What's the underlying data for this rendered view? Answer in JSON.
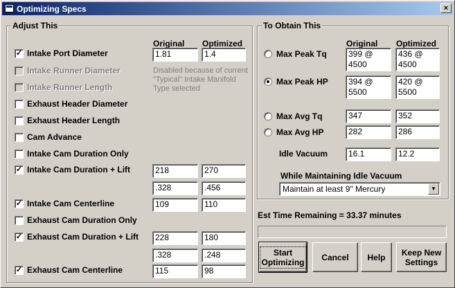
{
  "window": {
    "title": "Optimizing Specs",
    "close_glyph": "×"
  },
  "adjust": {
    "title": "Adjust This",
    "col_original": "Original",
    "col_optimized": "Optimized",
    "disabled_note": "Disabled because of current \"Typical\" Intake Manifold Type selected",
    "items": [
      {
        "label": "Intake Port Diameter",
        "checked": true,
        "enabled": true,
        "original": "1.81",
        "optimized": "1.4"
      },
      {
        "label": "Intake Runner Diameter",
        "checked": false,
        "enabled": false
      },
      {
        "label": "Intake Runner Length",
        "checked": false,
        "enabled": false
      },
      {
        "label": "Exhaust Header Diameter",
        "checked": false,
        "enabled": true
      },
      {
        "label": "Exhaust Header Length",
        "checked": false,
        "enabled": true
      },
      {
        "label": "Cam Advance",
        "checked": false,
        "enabled": true
      },
      {
        "label": "Intake Cam Duration Only",
        "checked": false,
        "enabled": true
      },
      {
        "label": "Intake Cam Duration + Lift",
        "checked": true,
        "enabled": true,
        "original": "218",
        "optimized": "270",
        "original2": ".328",
        "optimized2": ".456"
      },
      {
        "label": "Intake Cam Centerline",
        "checked": true,
        "enabled": true,
        "original": "109",
        "optimized": "110"
      },
      {
        "label": "Exhaust Cam Duration Only",
        "checked": false,
        "enabled": true
      },
      {
        "label": "Exhaust Cam Duration + Lift",
        "checked": true,
        "enabled": true,
        "original": "228",
        "optimized": "180",
        "original2": ".328",
        "optimized2": ".248"
      },
      {
        "label": "Exhaust Cam Centerline",
        "checked": true,
        "enabled": true,
        "original": "115",
        "optimized": "98"
      }
    ]
  },
  "obtain": {
    "title": "To Obtain This",
    "col_original": "Original",
    "col_optimized": "Optimized",
    "options": [
      {
        "label": "Max Peak Tq",
        "selected": false,
        "original": "399 @\n4500",
        "optimized": "436 @\n4500"
      },
      {
        "label": "Max Peak HP",
        "selected": true,
        "original": "394 @\n5500",
        "optimized": "420 @\n5500"
      },
      {
        "label": "Max Avg Tq",
        "selected": false,
        "original": "347",
        "optimized": "352"
      },
      {
        "label": "Max Avg HP",
        "selected": false,
        "original": "282",
        "optimized": "286"
      }
    ],
    "idle_vacuum": {
      "label": "Idle Vacuum",
      "original": "16.1",
      "optimized": "12.2"
    },
    "maintain_label": "While Maintaining Idle Vacuum",
    "maintain_value": "Maintain at least 9\" Mercury",
    "dropdown_glyph": "▼"
  },
  "status": {
    "time_remaining": "Est Time Remaining = 33.37 minutes",
    "progress": 0
  },
  "buttons": {
    "start": "Start Optimizing",
    "cancel": "Cancel",
    "help": "Help",
    "keep": "Keep New Settings"
  },
  "check_glyph": "✓"
}
